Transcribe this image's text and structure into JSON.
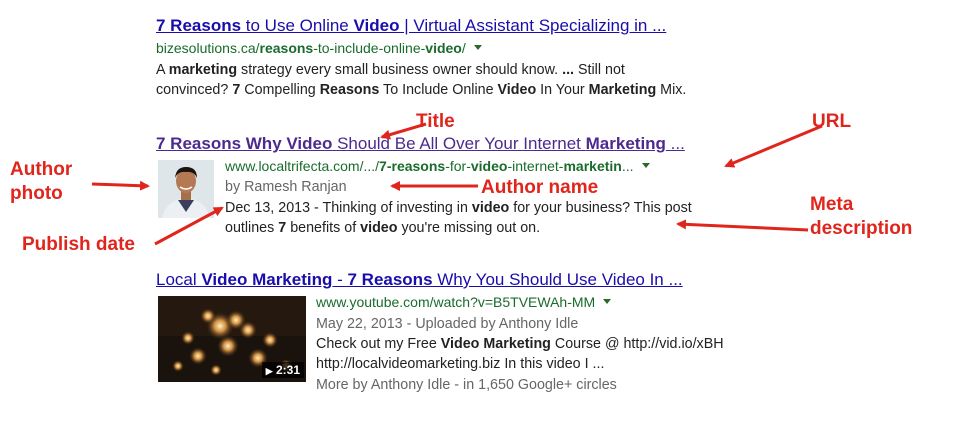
{
  "result1": {
    "title": [
      "7 Reasons",
      " to Use Online ",
      "Video",
      " | Virtual Assistant Specializing in ..."
    ],
    "url": [
      "bizesolutions.ca/",
      "reasons",
      "-to-include-online-",
      "video",
      "/"
    ],
    "snippet_line1": [
      "A ",
      "marketing",
      " strategy every small business owner should know. ",
      "...",
      " Still not"
    ],
    "snippet_line2": [
      "convinced? ",
      "7",
      " Compelling ",
      "Reasons",
      " To Include Online ",
      "Video",
      " In Your ",
      "Marketing",
      " Mix."
    ]
  },
  "result2": {
    "title": [
      "7 Reasons Why Video",
      " Should Be All Over Your Internet ",
      "Marketing",
      " ..."
    ],
    "url": [
      "www.localtrifecta.com/.../",
      "7-reasons",
      "-for-",
      "video",
      "-internet-",
      "marketin",
      "..."
    ],
    "author": "by Ramesh Ranjan",
    "snippet_line1": [
      "Dec 13, 2013 - Thinking of investing in ",
      "video",
      " for your business? This post"
    ],
    "snippet_line2": [
      "outlines ",
      "7",
      " benefits of ",
      "video",
      " you're missing out on."
    ]
  },
  "result3": {
    "title": [
      "Local ",
      "Video Marketing",
      " - ",
      "7 Reasons",
      " Why You Should Use Video In ..."
    ],
    "url": "www.youtube.com/watch?v=B5TVEWAh-MM",
    "uploaded": "May 22, 2013 - Uploaded by Anthony Idle",
    "snippet_line1": [
      "Check out my Free ",
      "Video Marketing",
      " Course @ http://vid.io/xBH"
    ],
    "snippet_line2": "http://localvideomarketing.biz In this video I ...",
    "more": "More by Anthony Idle - in 1,650 Google+ circles",
    "duration": "2:31"
  },
  "annotations": {
    "title": "Title",
    "url": "URL",
    "author_photo": "Author\nphoto",
    "author_name": "Author name",
    "publish_date": "Publish date",
    "meta_description": "Meta\ndescription"
  },
  "colors": {
    "link": "#1a0dab",
    "visited": "#4c2a8f",
    "url": "#1a6b2c",
    "annotation": "#e0261c"
  }
}
